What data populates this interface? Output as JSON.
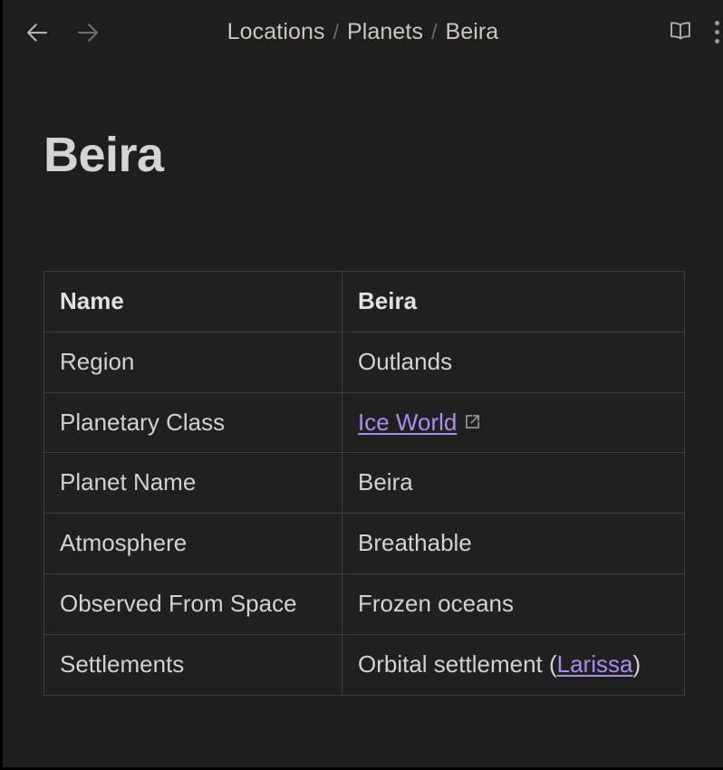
{
  "window": {
    "title": "Beira",
    "background_color": "#1e1e1e"
  },
  "topbar": {
    "back_label": "Back",
    "forward_label": "Forward",
    "back_icon": "arrow-left-icon",
    "forward_icon": "arrow-right-icon",
    "book_icon": "book-icon",
    "book_label": "Reader view",
    "menu_icon": "kebab-menu-icon",
    "menu_label": "More options"
  },
  "breadcrumb": {
    "separator": "/",
    "items": [
      {
        "label": "Locations"
      },
      {
        "label": "Planets"
      },
      {
        "label": "Beira"
      }
    ]
  },
  "page": {
    "title": "Beira"
  },
  "infobox": {
    "header": {
      "key": "Name",
      "value": "Beira"
    },
    "rows": [
      {
        "key": "Region",
        "value": "Outlands",
        "link": null,
        "external": false
      },
      {
        "key": "Planetary Class",
        "value": "Ice World",
        "link": "Ice World",
        "external": true
      },
      {
        "key": "Planet Name",
        "value": "Beira",
        "link": null,
        "external": false
      },
      {
        "key": "Atmosphere",
        "value": "Breathable",
        "link": null,
        "external": false
      },
      {
        "key": "Observed From Space",
        "value": "Frozen oceans",
        "link": null,
        "external": false
      },
      {
        "key": "Settlements",
        "value_prefix": "Orbital settlement (",
        "link": "Larissa",
        "value_suffix": ")",
        "external": false
      }
    ]
  },
  "colors": {
    "link": "#a98eea",
    "text": "#d2d2d2",
    "muted": "#6f6d6a",
    "border": "#3d3d3d"
  }
}
